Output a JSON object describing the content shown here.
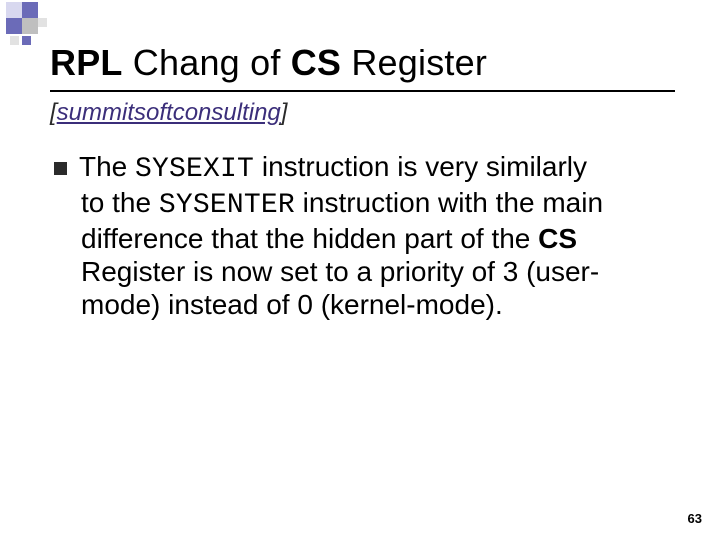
{
  "deco": {
    "accent_color": "#6b6bb8",
    "light_color": "#d8d8ef",
    "gray_color": "#bfbfbf",
    "gray_light": "#e2e2e2"
  },
  "title": {
    "t1b": "RPL",
    "t2": " Chang of ",
    "t3b": "CS",
    "t4": " Register"
  },
  "subtitle": {
    "open": "[",
    "link": "summitsoftconsulting",
    "close": "]"
  },
  "body": {
    "p1a": "The ",
    "p1_sysexit": "SYSEXIT",
    "p1b": " instruction is very similarly",
    "p2a": "to the ",
    "p2_sysenter": "SYSENTER",
    "p2b": " instruction with the main",
    "p3": "difference that the hidden part of the ",
    "p3_cs": "CS",
    "p4": "Register is now set to a priority of 3 (user-",
    "p5": "mode) instead of 0 (kernel-mode)."
  },
  "pagenum": "63"
}
